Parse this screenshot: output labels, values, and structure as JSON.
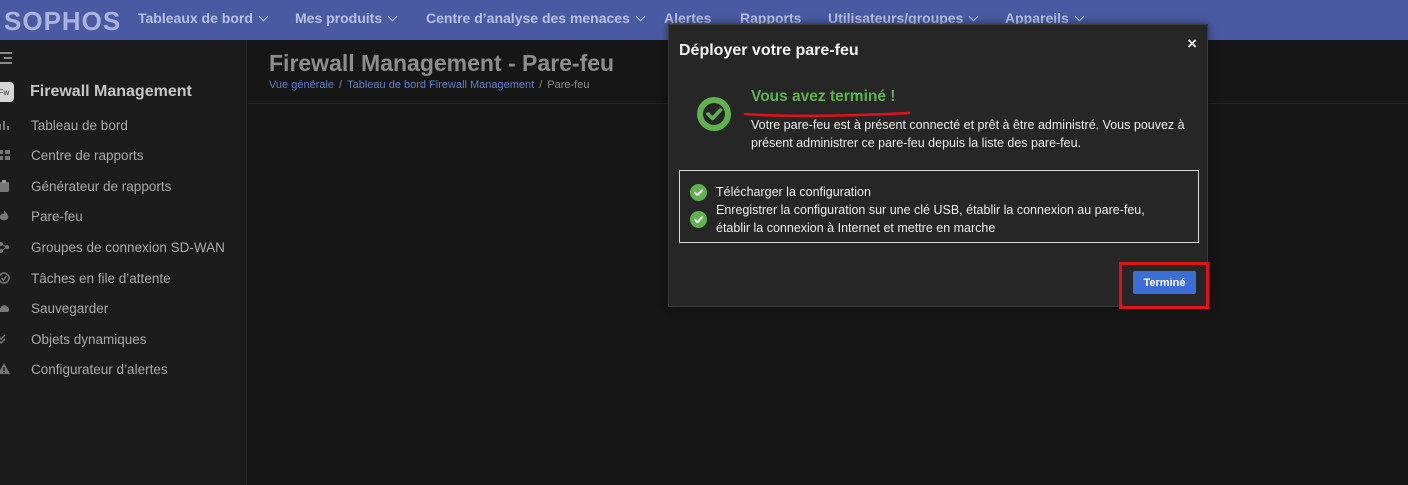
{
  "brand": "SOPHOS",
  "nav": [
    {
      "label": "Tableaux de bord",
      "chevron": true
    },
    {
      "label": "Mes produits",
      "chevron": true
    },
    {
      "label": "Centre d’analyse des menaces",
      "chevron": true
    },
    {
      "label": "Alertes",
      "chevron": false
    },
    {
      "label": "Rapports",
      "chevron": false
    },
    {
      "label": "Utilisateurs/groupes",
      "chevron": true
    },
    {
      "label": "Appareils",
      "chevron": true
    }
  ],
  "sidebar": {
    "badge": "Fw",
    "title": "Firewall Management",
    "items": [
      {
        "label": "Tableau de bord",
        "icon": "bar-chart-icon"
      },
      {
        "label": "Centre de rapports",
        "icon": "grid-icon"
      },
      {
        "label": "Générateur de rapports",
        "icon": "clipboard-icon"
      },
      {
        "label": "Pare-feu",
        "icon": "flame-icon"
      },
      {
        "label": "Groupes de connexion SD-WAN",
        "icon": "network-icon"
      },
      {
        "label": "Tâches en file d’attente",
        "icon": "check-circle-icon"
      },
      {
        "label": "Sauvegarder",
        "icon": "cloud-icon"
      },
      {
        "label": "Objets dynamiques",
        "icon": "double-check-icon"
      },
      {
        "label": "Configurateur d’alertes",
        "icon": "warning-icon"
      }
    ]
  },
  "page": {
    "title": "Firewall Management - Pare-feu",
    "breadcrumb": [
      "Vue générale",
      "Tableau de bord Firewall Management",
      "Pare-feu"
    ],
    "breadcrumb_sep": "/"
  },
  "modal": {
    "title": "Déployer votre pare-feu",
    "close": "×",
    "success_title": "Vous avez terminé !",
    "success_text": "Votre pare-feu est à présent connecté et prêt à être administré. Vous pouvez à présent administrer ce pare-feu depuis la liste des pare-feu.",
    "steps": [
      "Télécharger la configuration",
      "Enregistrer la configuration sur une clé USB, établir la connexion au pare-feu,",
      "établir la connexion à Internet et mettre en marche"
    ],
    "done_button": "Terminé"
  },
  "colors": {
    "nav_bg": "#4a5aa2",
    "success_green": "#5fb34e",
    "primary_button": "#3c6fd6",
    "highlight_red": "#e0121a"
  }
}
